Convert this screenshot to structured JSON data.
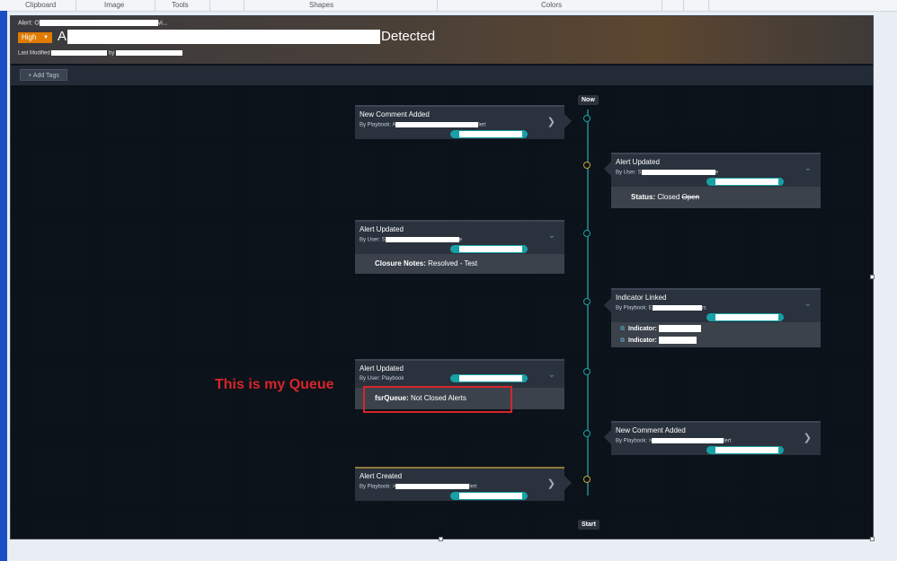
{
  "ribbon": {
    "clipboard": "Clipboard",
    "image": "Image",
    "tools": "Tools",
    "shapes": "Shapes",
    "colors": "Colors"
  },
  "header": {
    "alert_prefix": "Alert: O",
    "alert_suffix": "vi...",
    "severity": "High",
    "title_start": "A",
    "title_end": "Detected",
    "last_modified": "Last Modified",
    "by": "by"
  },
  "tags": {
    "add_label": "+ Add Tags"
  },
  "timeline": {
    "now": "Now",
    "start": "Start"
  },
  "events": [
    {
      "title": "New Comment Added",
      "by": "By Playbook: A",
      "by_tail": "lert"
    },
    {
      "title": "Alert Updated",
      "by": "By User: S",
      "by_tail": "e",
      "detail_label": "Status:",
      "detail_value": "Closed",
      "detail_old": "Open"
    },
    {
      "title": "Alert Updated",
      "by": "By User: S",
      "by_tail": "e",
      "detail_label": "Closure Notes:",
      "detail_value": "Resolved - Test"
    },
    {
      "title": "Indicator Linked",
      "by": "By Playbook: E",
      "by_tail": "rs",
      "indicator_label": "Indicator:"
    },
    {
      "title": "Alert Updated",
      "by": "By User: Playbook",
      "detail_label": "fsrQueue:",
      "detail_value": "Not Closed Alerts"
    },
    {
      "title": "New Comment Added",
      "by": "By Playbook: >",
      "by_tail": "lert"
    },
    {
      "title": "Alert Created",
      "by": "By Playbook: >",
      "by_tail": "lert"
    }
  ],
  "annotation": {
    "text": "This is my Queue",
    "color": "#d6252a"
  },
  "colors": {
    "severity": "#e07b00",
    "teal": "#17a0a6",
    "gold": "#c3a43d"
  },
  "icons": {
    "chevron_right": "chevron-right-icon",
    "chevron_down": "chevron-down-icon",
    "external_link": "external-link-icon",
    "dropdown_caret": "caret-down-icon"
  }
}
